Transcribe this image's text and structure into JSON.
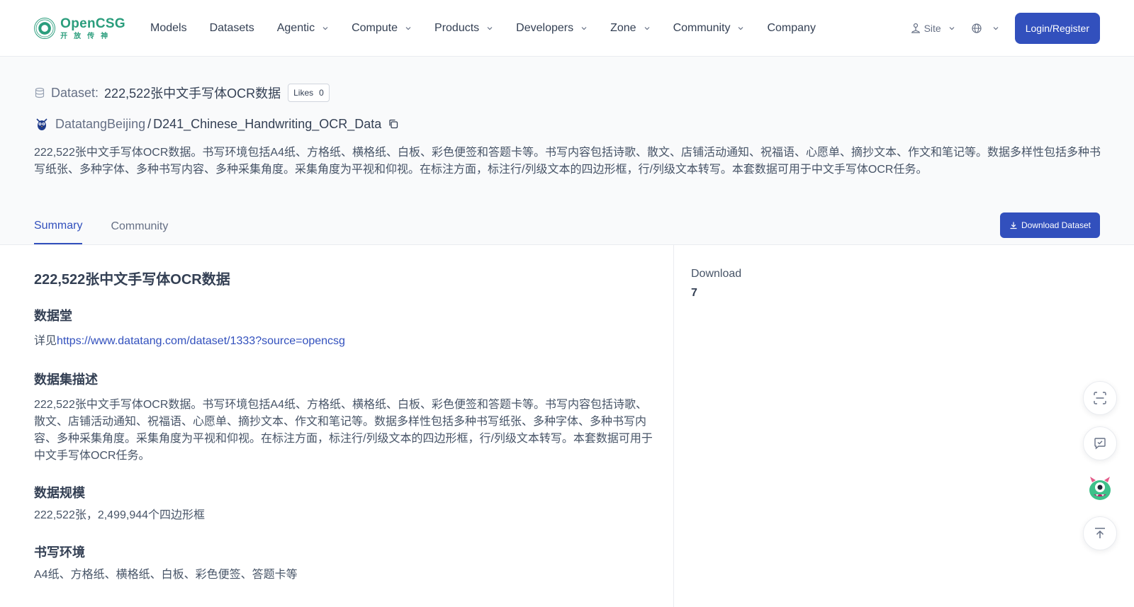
{
  "header": {
    "logo_name": "OpenCSG",
    "logo_sub": "开放传神",
    "nav": [
      {
        "label": "Models",
        "dropdown": false
      },
      {
        "label": "Datasets",
        "dropdown": false
      },
      {
        "label": "Agentic",
        "dropdown": true
      },
      {
        "label": "Compute",
        "dropdown": true
      },
      {
        "label": "Products",
        "dropdown": true
      },
      {
        "label": "Developers",
        "dropdown": true
      },
      {
        "label": "Zone",
        "dropdown": true
      },
      {
        "label": "Community",
        "dropdown": true
      },
      {
        "label": "Company",
        "dropdown": false
      }
    ],
    "site_label": "Site",
    "login_label": "Login/Register"
  },
  "dataset": {
    "label": "Dataset:",
    "title": "222,522张中文手写体OCR数据",
    "likes_label": "Likes",
    "likes_count": "0",
    "owner": "DatatangBeijing",
    "separator": "/",
    "repo": "D241_Chinese_Handwriting_OCR_Data",
    "description": "222,522张中文手写体OCR数据。书写环境包括A4纸、方格纸、横格纸、白板、彩色便签和答题卡等。书写内容包括诗歌、散文、店铺活动通知、祝福语、心愿单、摘抄文本、作文和笔记等。数据多样性包括多种书写纸张、多种字体、多种书写内容、多种采集角度。采集角度为平视和仰视。在标注方面，标注行/列级文本的四边形框，行/列级文本转写。本套数据可用于中文手写体OCR任务。"
  },
  "tabs": [
    {
      "label": "Summary",
      "active": true
    },
    {
      "label": "Community",
      "active": false
    }
  ],
  "download_button": "Download Dataset",
  "readme": {
    "h1": "222,522张中文手写体OCR数据",
    "sec1_title": "数据堂",
    "sec1_prefix": "详见",
    "sec1_link": "https://www.datatang.com/dataset/1333?source=opencsg",
    "sec2_title": "数据集描述",
    "sec2_text": "222,522张中文手写体OCR数据。书写环境包括A4纸、方格纸、横格纸、白板、彩色便签和答题卡等。书写内容包括诗歌、散文、店铺活动通知、祝福语、心愿单、摘抄文本、作文和笔记等。数据多样性包括多种书写纸张、多种字体、多种书写内容、多种采集角度。采集角度为平视和仰视。在标注方面，标注行/列级文本的四边形框，行/列级文本转写。本套数据可用于中文手写体OCR任务。",
    "sec3_title": "数据规模",
    "sec3_text": "222,522张，2,499,944个四边形框",
    "sec4_title": "书写环境",
    "sec4_text": "A4纸、方格纸、横格纸、白板、彩色便签、答题卡等"
  },
  "sidebar": {
    "download_label": "Download",
    "download_count": "7"
  },
  "colors": {
    "brand": "#3250bd",
    "logo": "#2a9d7c"
  },
  "icons": [
    "database-icon",
    "copy-icon",
    "scan-icon",
    "check-message-icon",
    "mascot-icon",
    "back-to-top-icon",
    "globe-icon",
    "site-icon",
    "download-icon"
  ]
}
